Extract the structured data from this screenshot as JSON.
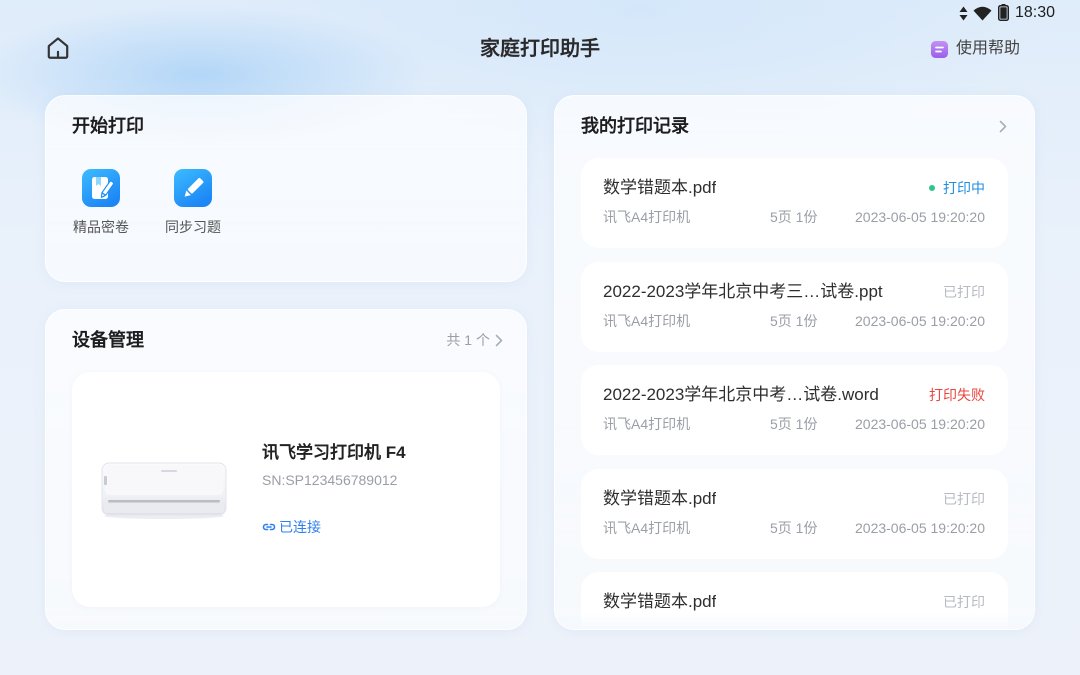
{
  "status_bar": {
    "time": "18:30",
    "icons": [
      "data-arrows-icon",
      "wifi-icon",
      "battery-icon"
    ]
  },
  "header": {
    "home_icon": "home-icon",
    "title": "家庭打印助手",
    "help_icon": "help-doc-icon",
    "help_label": "使用帮助"
  },
  "start_print": {
    "title": "开始打印",
    "items": [
      {
        "label": "精品密卷",
        "icon": "exam-paper-icon"
      },
      {
        "label": "同步习题",
        "icon": "pencil-edit-icon"
      }
    ]
  },
  "devices": {
    "title": "设备管理",
    "count_label": "共 1 个",
    "device": {
      "name": "讯飞学习打印机 F4",
      "sn": "SN:SP123456789012",
      "status": "已连接",
      "status_icon": "link-icon"
    }
  },
  "records": {
    "title": "我的打印记录",
    "items": [
      {
        "file": "数学错题本.pdf",
        "status": "打印中",
        "status_color": "#1f8fe0",
        "status_dot_color": "#30c48e",
        "printer": "讯飞A4打印机",
        "pages": "5页 1份",
        "time": "2023-06-05 19:20:20"
      },
      {
        "file": "2022-2023学年北京中考三…试卷.ppt",
        "status": "已打印",
        "status_color": "#b6bac2",
        "printer": "讯飞A4打印机",
        "pages": "5页 1份",
        "time": "2023-06-05 19:20:20"
      },
      {
        "file": "2022-2023学年北京中考…试卷.word",
        "status": "打印失败",
        "status_color": "#e8463d",
        "printer": "讯飞A4打印机",
        "pages": "5页 1份",
        "time": "2023-06-05 19:20:20"
      },
      {
        "file": "数学错题本.pdf",
        "status": "已打印",
        "status_color": "#b6bac2",
        "printer": "讯飞A4打印机",
        "pages": "5页 1份",
        "time": "2023-06-05 19:20:20"
      },
      {
        "file": "数学错题本.pdf",
        "status": "已打印",
        "status_color": "#b6bac2"
      }
    ]
  },
  "colors": {
    "accent": "#2f80ed",
    "icon_gradient_start": "#3cbcff",
    "icon_gradient_end": "#1c86f6",
    "help_icon": "#9b5fe8",
    "status_printing": "#1f8fe0",
    "status_printing_dot": "#30c48e",
    "status_done": "#b6bac2",
    "status_failed": "#e8463d"
  }
}
